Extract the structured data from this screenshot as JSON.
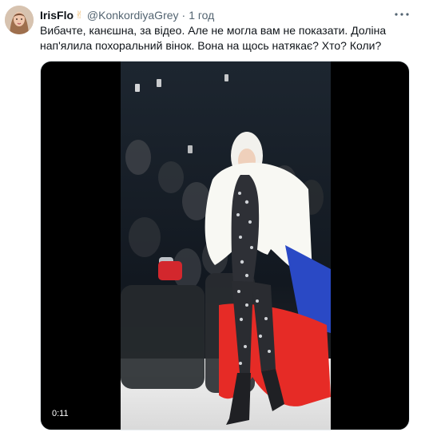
{
  "tweet": {
    "display_name": "IrisFlo",
    "emoji": "✌",
    "handle": "@KonkordiyaGrey",
    "separator": "·",
    "time": "1 год",
    "text": "Вибачте, канєшна, за відео. Але не могла вам не показати. Доліна нап'ялила похоральний вінок. Вона на щось натякає? Хто? Коли?"
  },
  "icons": {
    "more": "more-horizontal-icon",
    "avatar": "avatar-image",
    "emoji": "victory-hand-icon"
  },
  "media": {
    "type": "video",
    "timestamp": "0:11"
  },
  "colors": {
    "text_primary": "#0f1419",
    "text_secondary": "#536471",
    "media_background": "#000000"
  }
}
